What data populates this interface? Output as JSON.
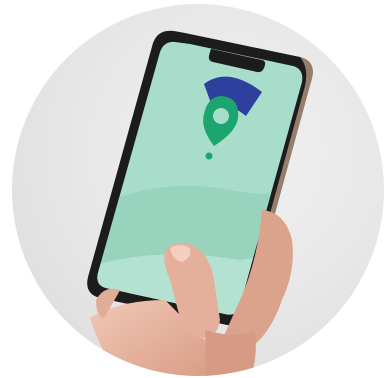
{
  "image": {
    "subject": "hand-holding-smartphone",
    "colors": {
      "background": "#e6e6e6",
      "screen": "#a8dccb",
      "screen_wave": "#94d0bc",
      "pin": "#1aa66e",
      "arc": "#2f3f9e",
      "phone_frame": "#1c1c1c",
      "skin": "#e8b8a4"
    },
    "icons": [
      "location-pin-icon",
      "signal-arc-icon"
    ]
  }
}
